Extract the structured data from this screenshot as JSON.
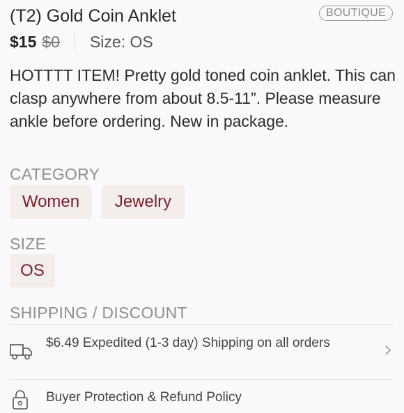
{
  "listing": {
    "title": "(T2) Gold Coin Anklet",
    "badge": "BOUTIQUE",
    "price": "$15",
    "original_price": "$0",
    "size_text": "Size: OS",
    "description": "HOTTTT ITEM! Pretty gold toned coin anklet. This can clasp anywhere from about 8.5-11”. Please measure ankle before ordering. New in package."
  },
  "category": {
    "label": "CATEGORY",
    "items": [
      "Women",
      "Jewelry"
    ]
  },
  "size": {
    "label": "SIZE",
    "value": "OS"
  },
  "shipping": {
    "label": "SHIPPING / DISCOUNT",
    "shipping_text": "$6.49 Expedited (1-3 day) Shipping on all orders",
    "shipping_icon": "truck-icon",
    "buyer_protection_text": "Buyer Protection & Refund Policy",
    "buyer_protection_icon": "lock-icon"
  },
  "colors": {
    "chip_text": "#7a1f2b",
    "chip_bg": "#f3eeec",
    "background": "#fbf9f9"
  }
}
